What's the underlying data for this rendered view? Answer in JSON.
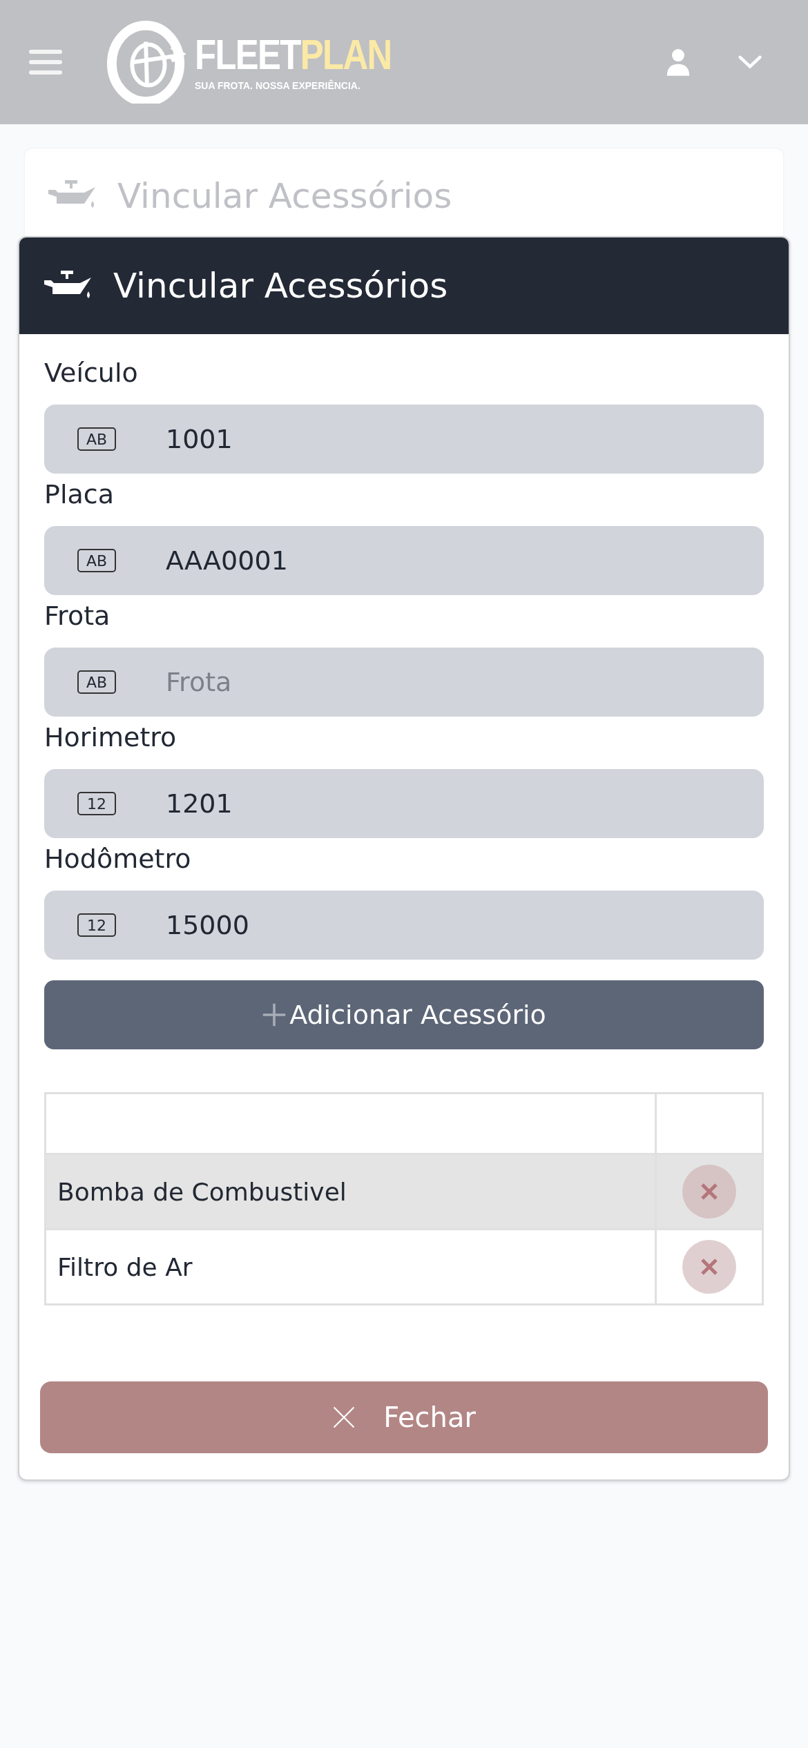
{
  "header": {
    "brand_first": "FLEET",
    "brand_second": "PLAN",
    "tagline": "SUA FROTA. NOSSA EXPERIÊNCIA."
  },
  "page_title": "Vincular Acessórios",
  "modal": {
    "title": "Vincular Acessórios",
    "fields": [
      {
        "label": "Veículo",
        "icon_text": "AB",
        "value": "1001"
      },
      {
        "label": "Placa",
        "icon_text": "AB",
        "value": "AAA0001"
      },
      {
        "label": "Frota",
        "icon_text": "AB",
        "placeholder": "Frota"
      },
      {
        "label": "Horimetro",
        "icon_text": "12",
        "value": "1201"
      },
      {
        "label": "Hodômetro",
        "icon_text": "12",
        "value": "15000"
      }
    ],
    "add_button": "Adicionar Acessório",
    "rows": [
      {
        "name": "Bomba de Combustivel",
        "highlighted": true
      },
      {
        "name": "Filtro de Ar",
        "highlighted": false
      }
    ],
    "close_button": "Fechar"
  }
}
